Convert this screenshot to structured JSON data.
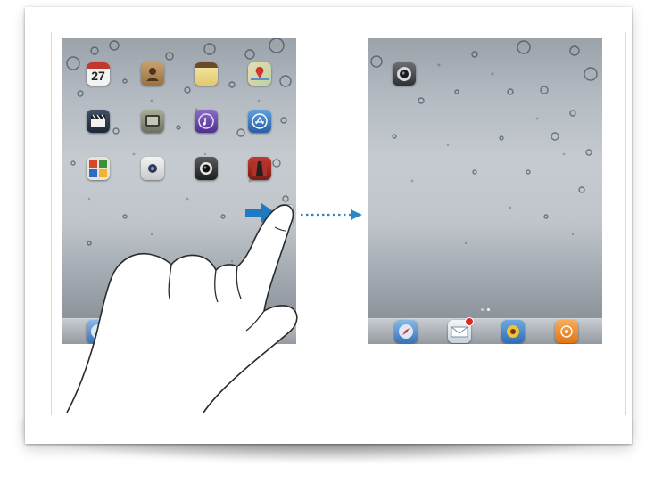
{
  "left_screen": {
    "calendar_day": "27",
    "icons": [
      {
        "name": "calendar-app-icon",
        "color": "#e8e8e8"
      },
      {
        "name": "contacts-app-icon",
        "color": "#b98d55"
      },
      {
        "name": "notes-app-icon",
        "color": "#e9d48a"
      },
      {
        "name": "maps-app-icon",
        "color": "#d8c79a"
      },
      {
        "name": "videos-app-icon",
        "color": "#2e3a4a"
      },
      {
        "name": "youtube-app-icon",
        "color": "#8a8e7a"
      },
      {
        "name": "itunes-app-icon",
        "color": "#6c4aa8"
      },
      {
        "name": "app-store-app-icon",
        "color": "#3a77c4"
      },
      {
        "name": "game-center-app-icon",
        "color": "#5d8c3a"
      },
      {
        "name": "facetime-app-icon",
        "color": "#dcdcdc"
      },
      {
        "name": "camera-app-icon",
        "color": "#3a3a3a"
      },
      {
        "name": "photo-booth-app-icon",
        "color": "#a3312a"
      }
    ],
    "dock_icons": [
      {
        "name": "safari-dock-icon",
        "color": "#4a86c5"
      },
      {
        "name": "ipod-dock-icon",
        "color": "#f08a1d"
      }
    ]
  },
  "right_screen": {
    "icons": [
      {
        "name": "camera-app-icon",
        "color": "#55585c"
      }
    ],
    "dock_icons": [
      {
        "name": "safari-dock-icon",
        "color": "#4a86c5"
      },
      {
        "name": "mail-dock-icon",
        "color": "#e8eef5"
      },
      {
        "name": "photos-dock-icon",
        "color": "#f2c233"
      },
      {
        "name": "ipod-dock-icon",
        "color": "#f08a1d"
      }
    ]
  },
  "colors": {
    "swipe_arrow": "#1f7ac2",
    "dotted_arrow": "#2a86c8"
  }
}
